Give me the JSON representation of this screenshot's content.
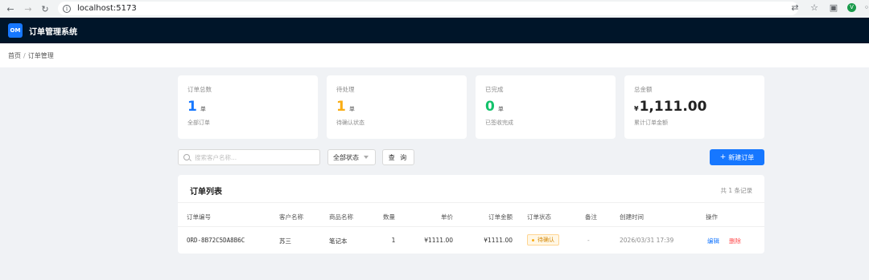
{
  "browser": {
    "url": "localhost:5173"
  },
  "app": {
    "logo_text": "OM",
    "title": "订单管理系统"
  },
  "breadcrumb": {
    "items": [
      "首页",
      "订单管理"
    ],
    "separator": "/"
  },
  "stats": [
    {
      "label": "订单总数",
      "value": "1",
      "unit": "单",
      "sub": "全部订单",
      "color": "#1677ff"
    },
    {
      "label": "待处理",
      "value": "1",
      "unit": "单",
      "sub": "待确认状态",
      "color": "#faad14"
    },
    {
      "label": "已完成",
      "value": "0",
      "unit": "单",
      "sub": "已签收完成",
      "color": "#13c26b"
    },
    {
      "label": "总金额",
      "currency": "¥",
      "value": "1,111.00",
      "sub": "累计订单金额",
      "color": "#222222"
    }
  ],
  "toolbar": {
    "search_placeholder": "搜索客户名称...",
    "status_select": "全部状态",
    "query_label": "查 询",
    "new_label": "新建订单"
  },
  "table": {
    "title": "订单列表",
    "count_text": "共 1 条记录",
    "columns": [
      "订单编号",
      "客户名称",
      "商品名称",
      "数量",
      "单价",
      "订单金额",
      "订单状态",
      "备注",
      "创建时间",
      "操作"
    ],
    "rows": [
      {
        "order_no": "ORD-8B72C5DA8B6C",
        "customer": "苏三",
        "product": "笔记本",
        "qty": "1",
        "unit_price": "¥1111.00",
        "amount": "¥1111.00",
        "status": "待确认",
        "remark": "-",
        "created": "2026/03/31 17:39",
        "actions": {
          "edit": "编辑",
          "delete": "删除"
        }
      }
    ]
  },
  "colors": {
    "primary": "#1677ff",
    "header_bg": "#001529",
    "danger": "#ff4d4f",
    "warning": "#faad14"
  }
}
